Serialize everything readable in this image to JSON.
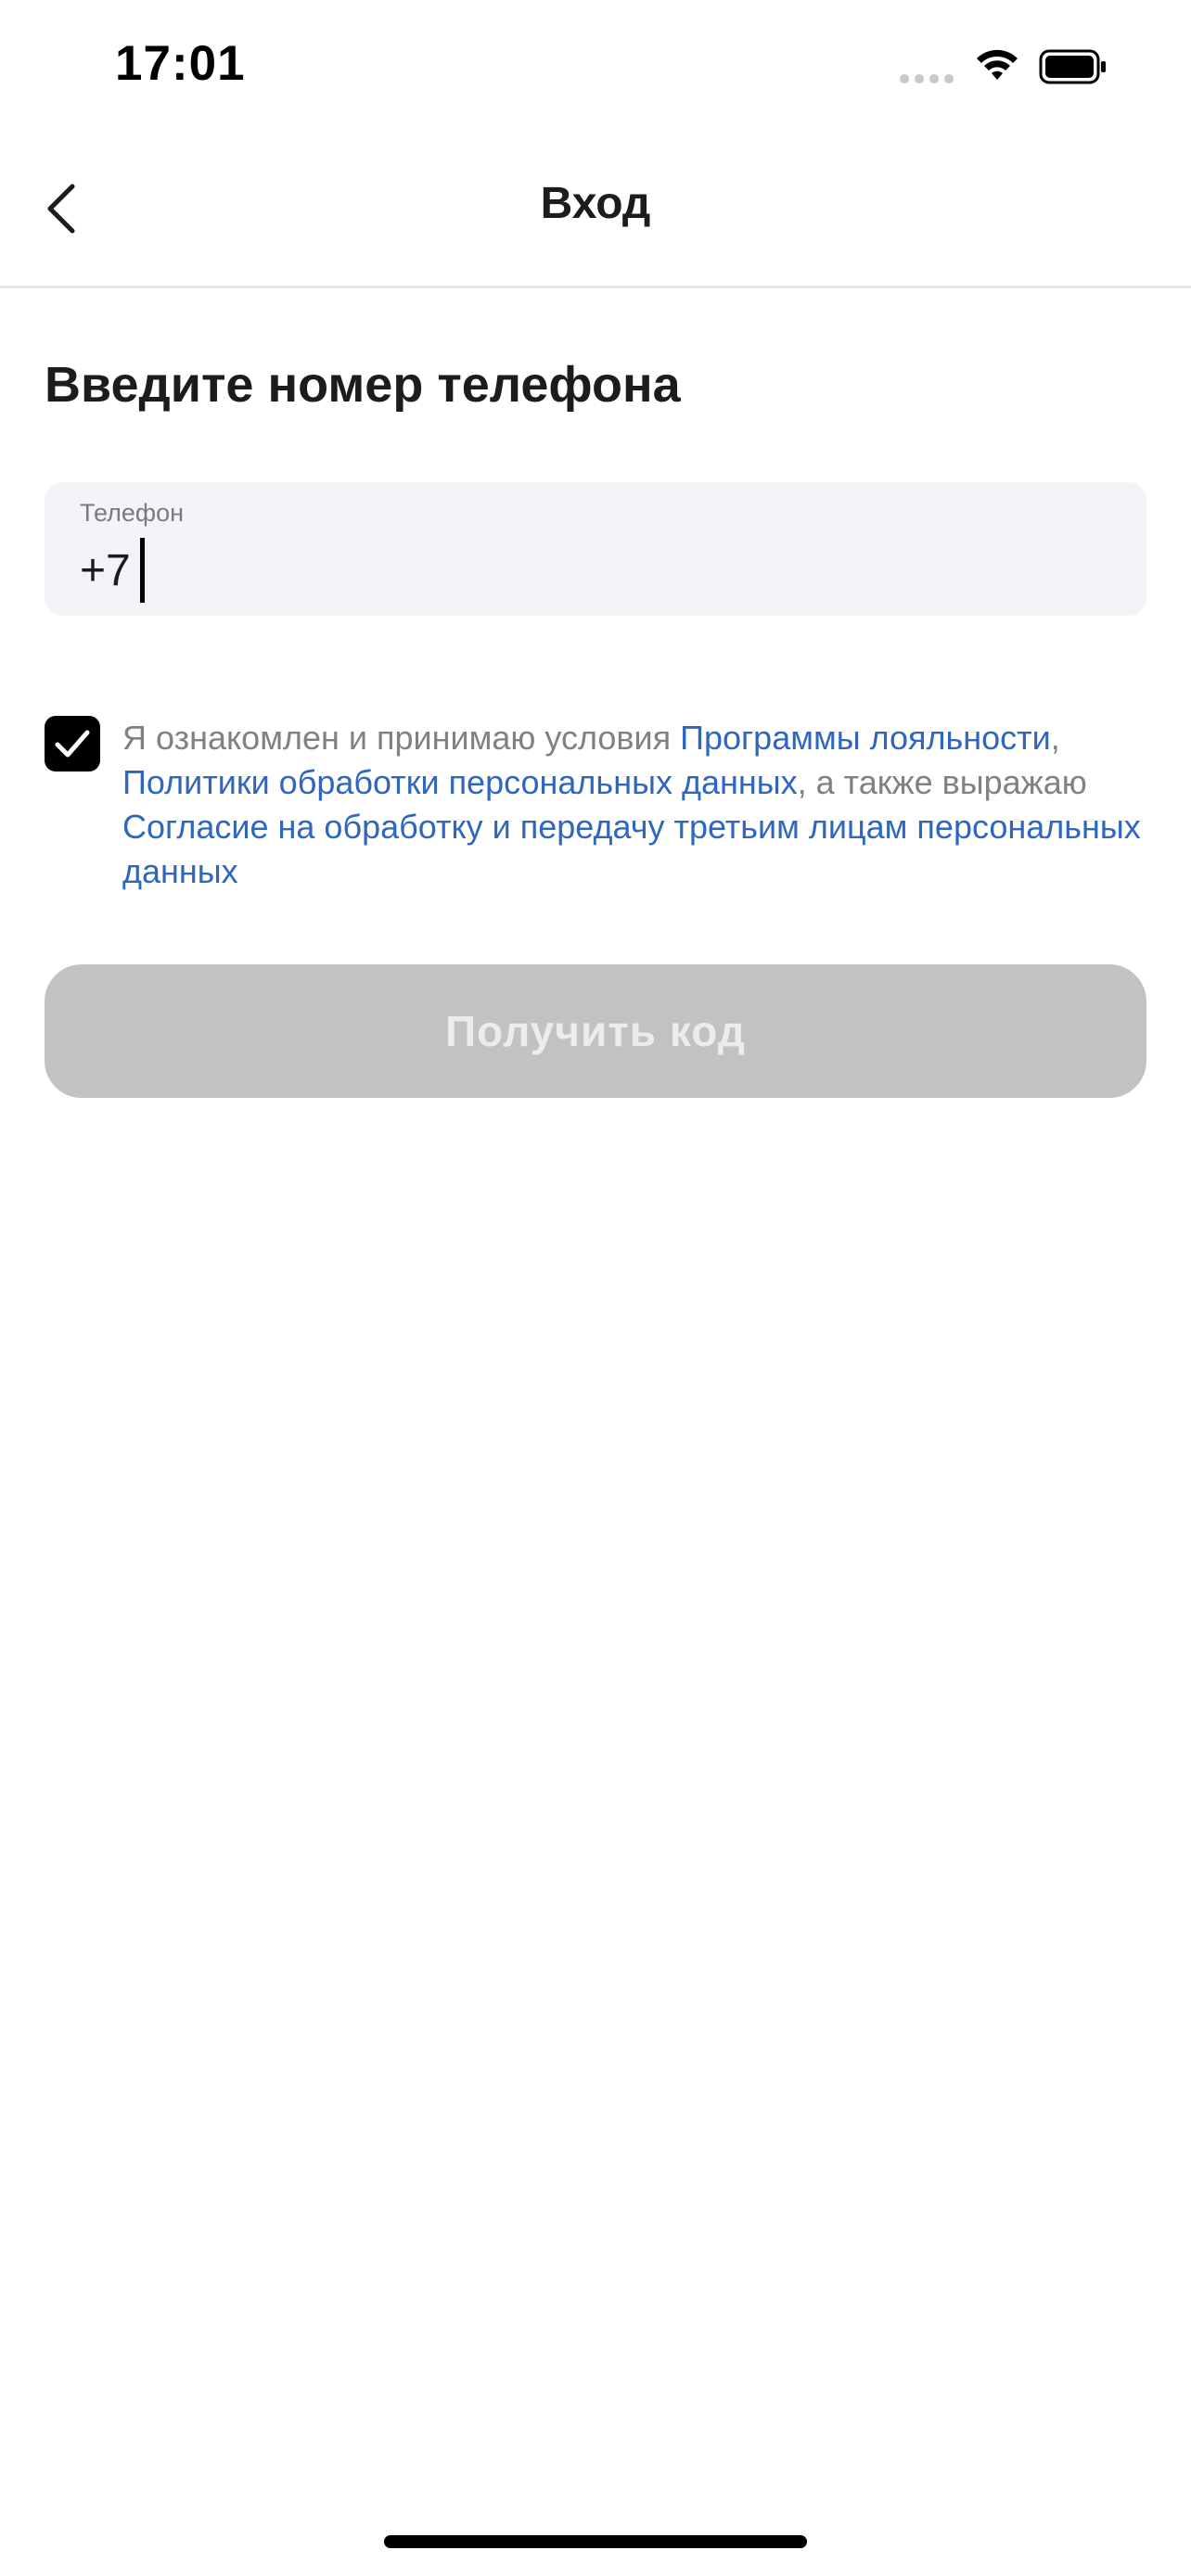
{
  "status_bar": {
    "time": "17:01"
  },
  "nav": {
    "title": "Вход",
    "back_icon": "chevron-left-icon"
  },
  "heading": "Введите номер телефона",
  "phone_field": {
    "label": "Телефон",
    "value": "+7"
  },
  "consent": {
    "checked": true,
    "text_1": "Я ознакомлен и принимаю условия ",
    "link_loyalty": "Программы лояльности",
    "text_2": ", ",
    "link_privacy": "Политики обработки персональных данных",
    "text_3": ", а также выражаю ",
    "link_agreement": "Согласие на обработку и передачу третьим лицам персональных данных"
  },
  "submit": {
    "label": "Получить код",
    "enabled": false
  },
  "colors": {
    "link": "#2f67bf",
    "button_disabled": "#c2c2c2",
    "field_bg": "#f3f4f7"
  }
}
